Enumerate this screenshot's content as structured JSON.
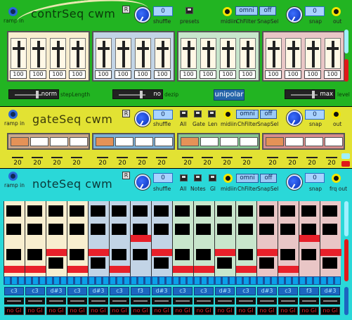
{
  "contrSeq": {
    "title": "contrSeq cwm",
    "r": "R",
    "ramp_in": "ramp in",
    "shuffle_val": "0",
    "shuffle": "shuffle",
    "presets": "presets",
    "midiin": "midiin",
    "chfilter_val": "omni",
    "chfilter": "ChFilter",
    "snapsel_val": "off",
    "snapsel": "SnapSel",
    "snap_val": "0",
    "snap": "snap",
    "out": "out",
    "groups": [
      [
        "100",
        "100",
        "100",
        "100"
      ],
      [
        "100",
        "100",
        "100",
        "100"
      ],
      [
        "100",
        "100",
        "100",
        "100"
      ],
      [
        "100",
        "100",
        "100",
        "100"
      ]
    ],
    "step_length_val": "norm",
    "step_length": "stepLength",
    "dezip_val": "no",
    "dezip": "dezip",
    "unipolar": "unipolar",
    "level_val": "max",
    "level": "level"
  },
  "gateSeq": {
    "title": "gateSeq cwm",
    "r": "R",
    "ramp_in": "ramp in",
    "shuffle_val": "0",
    "shuffle": "shuffle",
    "all": "All",
    "gate": "Gate",
    "len": "Len",
    "midiin": "midiin",
    "chfilter_val": "omni",
    "chfilter": "ChFilter",
    "snapsel_val": "off",
    "snapsel": "SnapSel",
    "snap_val": "0",
    "snap": "snap",
    "out": "out",
    "lengths": [
      "20",
      "20",
      "20",
      "20",
      "20",
      "20",
      "20",
      "20",
      "20",
      "20",
      "20",
      "20",
      "20",
      "20",
      "20",
      "20"
    ]
  },
  "noteSeq": {
    "title": "noteSeq cwm",
    "r": "R",
    "ramp_in": "ramp in",
    "shuffle_val": "0",
    "shuffle": "shuffle",
    "all": "All",
    "notes": "Notes",
    "gl": "Gl",
    "midiin": "midiin",
    "chfilter_val": "omni",
    "chfilter": "ChFilter",
    "snapsel_val": "off",
    "snapsel": "SnapSel",
    "snap_val": "0",
    "snap": "snap",
    "frq_out": "frq out",
    "notes_row": [
      "c3",
      "c3",
      "d#3",
      "c3",
      "d#3",
      "c3",
      "f3",
      "d#3",
      "c3",
      "c3",
      "d#3",
      "c3",
      "d#3",
      "c3",
      "f3",
      "d#3"
    ],
    "glides": [
      "no Gl",
      "no Gl",
      "no Gl",
      "no Gl",
      "no Gl",
      "no Gl",
      "no Gl",
      "no Gl",
      "no Gl",
      "no Gl",
      "no Gl",
      "no Gl",
      "no Gl",
      "no Gl",
      "no Gl",
      "no Gl"
    ]
  }
}
